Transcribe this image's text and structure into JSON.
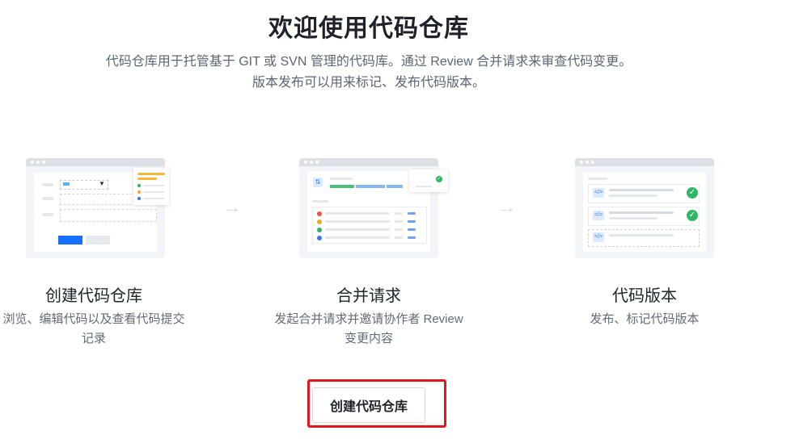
{
  "header": {
    "title": "欢迎使用代码仓库",
    "subtitle_line1": "代码仓库用于托管基于 GIT 或 SVN 管理的代码库。通过 Review 合并请求来审查代码变更。",
    "subtitle_line2": "版本发布可以用来标记、发布代码版本。"
  },
  "features": [
    {
      "title": "创建代码仓库",
      "desc_line1": "浏览、编辑代码以及查看代码提交",
      "desc_line2": "记录"
    },
    {
      "title": "合并请求",
      "desc_line1": "发起合并请求并邀请协作者 Review",
      "desc_line2": "变更内容"
    },
    {
      "title": "代码版本",
      "desc_line1": "发布、标记代码版本",
      "desc_line2": ""
    }
  ],
  "arrows": [
    "→",
    "→"
  ],
  "cta": {
    "label": "创建代码仓库"
  },
  "icons": {
    "merge": "merge-request-icon",
    "code": "code-icon",
    "check": "check-circle-icon"
  },
  "colors": {
    "primary": "#1670ff",
    "success": "#2fb766",
    "highlight": "#e6161d"
  }
}
